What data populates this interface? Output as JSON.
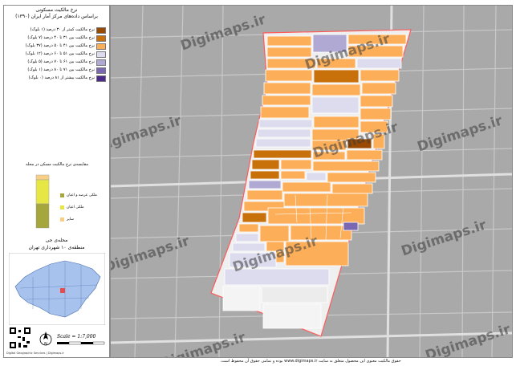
{
  "header": {
    "title": "نرخ مالکیت مسکونی",
    "subtitle": "براساس داده‌های مرکز آمار ایران (۱۳۹۰)"
  },
  "legend": {
    "items": [
      {
        "label": "نرخ مالکیت کمتر از ۳۰ درصد (۱ بلوک)",
        "color": "#9a4a00"
      },
      {
        "label": "نرخ مالکیت بین ۳۱ تا ۴۰ درصد (۷ بلوک)",
        "color": "#c8700a"
      },
      {
        "label": "نرخ مالکیت بین ۴۱ تا ۵۰ درصد (۳۷ بلوک)",
        "color": "#fcaf58"
      },
      {
        "label": "نرخ مالکیت بین ۵۱ تا ۶۰ درصد (۱۲ بلوک)",
        "color": "#dcdcee"
      },
      {
        "label": "نرخ مالکیت بین ۶۱ تا ۷۰ درصد (۵ بلوک)",
        "color": "#b0a9d3"
      },
      {
        "label": "نرخ مالکیت بین ۷۱ تا ۸۰ درصد (۱ بلوک)",
        "color": "#7b68b3"
      },
      {
        "label": "نرخ مالکیت بیشتر از ۸۱ درصد (۰ بلوک)",
        "color": "#4b2a8c"
      }
    ]
  },
  "ownership_chart": {
    "title": "مقایسه‌ی نرخ مالکیت مسکن در محله",
    "legend": [
      {
        "label": "ملکی عرصه و اعیان",
        "color": "#a5a63b"
      },
      {
        "label": "ملکی اعیان",
        "color": "#e6e645"
      },
      {
        "label": "سایر",
        "color": "#f7cf85"
      }
    ]
  },
  "locator": {
    "neighborhood": "محله‌ی جی",
    "district": "منطقه‌ی ۱۰ شهرداری تهران"
  },
  "scale": "Scale = 1:7,000",
  "watermark": "Digimaps.ir",
  "credits": "Digital Geographic Services | Digimaps.ir",
  "copyright": "حقوق مالکیت معنوی این محصول متعلق به سایت www.digimaps.ir بوده و تمامی حقوق آن محفوظ است."
}
